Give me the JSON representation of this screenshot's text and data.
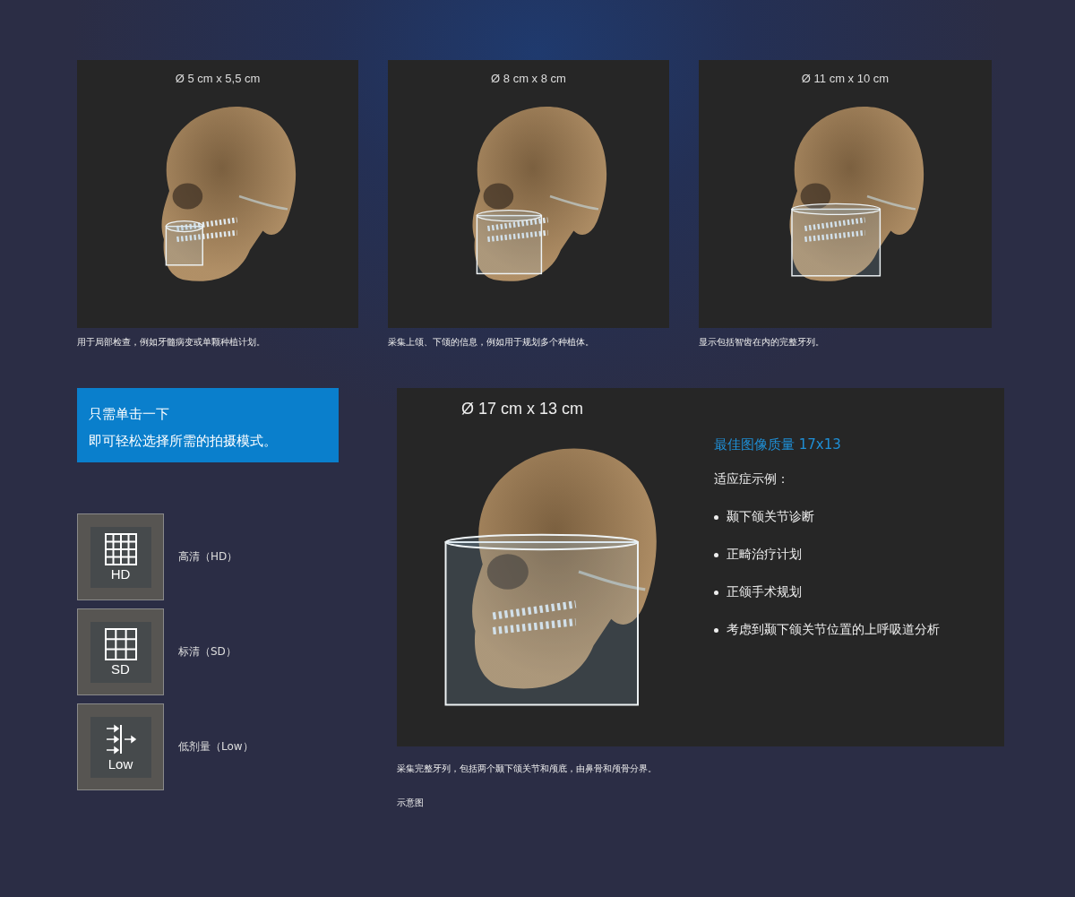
{
  "panels": [
    {
      "size": "Ø 5 cm x 5,5 cm",
      "caption": "用于局部检查，例如牙髓病变或单颗种植计划。"
    },
    {
      "size": "Ø 8 cm x 8 cm",
      "caption": "采集上颌、下颌的信息，例如用于规划多个种植体。"
    },
    {
      "size": "Ø 11 cm x 10 cm",
      "caption": "显示包括智齿在内的完整牙列。"
    }
  ],
  "callout": {
    "lines": [
      "只需单击一下",
      "即可轻松选择所需的拍摄模式。"
    ]
  },
  "modes": [
    {
      "kind": "hd",
      "badge": "HD",
      "label": "高清（HD）"
    },
    {
      "kind": "sd",
      "badge": "SD",
      "label": "标清（SD）"
    },
    {
      "kind": "low",
      "badge": "Low",
      "label": "低剂量（Low）"
    }
  ],
  "feature": {
    "size": "Ø 17 cm x 13 cm",
    "title": "最佳图像质量 17x13",
    "subtitle": "适应症示例：",
    "bullets": [
      "颞下颌关节诊断",
      "正畸治疗计划",
      "正颌手术规划",
      "考虑到颞下颌关节位置的上呼吸道分析"
    ],
    "caption": "采集完整牙列，包括两个颞下颌关节和颅底，由鼻骨和颅骨分界。",
    "note": "示意图"
  }
}
